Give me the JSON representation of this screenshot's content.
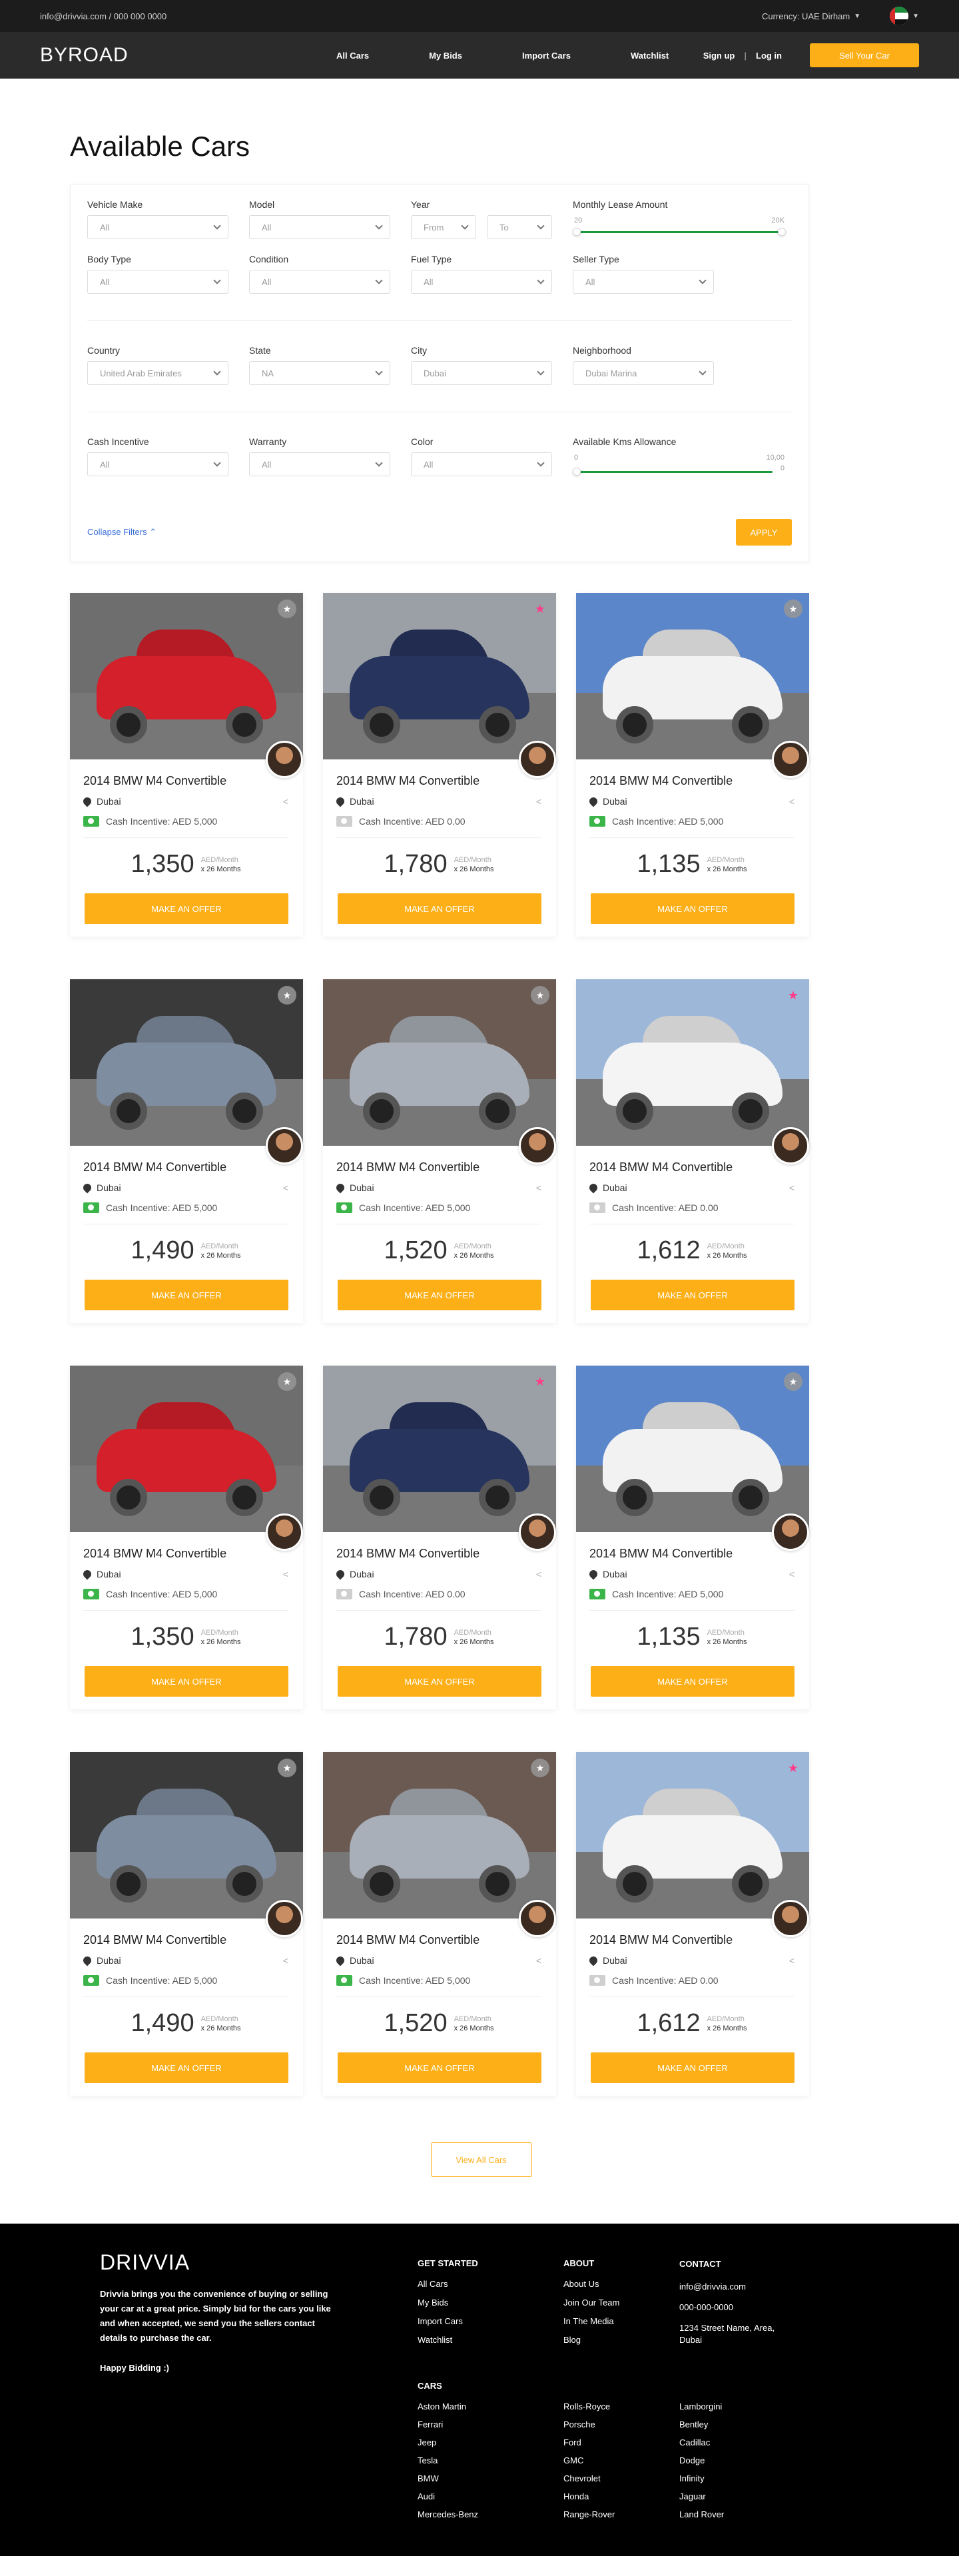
{
  "topbar": {
    "contact": "info@drivvia.com / 000 000 0000",
    "currency": "Currency: UAE Dirham"
  },
  "nav": {
    "logo": "BYROAD",
    "items": [
      "All Cars",
      "My Bids",
      "Import Cars",
      "Watchlist"
    ],
    "signup": "Sign up",
    "separator": "|",
    "login": "Log in",
    "sell_button": "Sell Your Car"
  },
  "page_title": "Available Cars",
  "filters": {
    "vehicle_make": {
      "label": "Vehicle Make",
      "value": "All"
    },
    "model": {
      "label": "Model",
      "value": "All"
    },
    "year": {
      "label": "Year",
      "from": "From",
      "to": "To"
    },
    "lease": {
      "label": "Monthly Lease Amount",
      "min": "20",
      "max": "20K"
    },
    "body_type": {
      "label": "Body Type",
      "value": "All"
    },
    "condition": {
      "label": "Condition",
      "value": "All"
    },
    "fuel_type": {
      "label": "Fuel Type",
      "value": "All"
    },
    "seller_type": {
      "label": "Seller Type",
      "value": "All"
    },
    "country": {
      "label": "Country",
      "value": "United Arab Emirates"
    },
    "state": {
      "label": "State",
      "value": "NA"
    },
    "city": {
      "label": "City",
      "value": "Dubai"
    },
    "neighborhood": {
      "label": "Neighborhood",
      "value": "Dubai Marina"
    },
    "cash_incentive": {
      "label": "Cash Incentive",
      "value": "All"
    },
    "warranty": {
      "label": "Warranty",
      "value": "All"
    },
    "color": {
      "label": "Color",
      "value": "All"
    },
    "kms": {
      "label": "Available Kms Allowance",
      "min": "0",
      "max": "10,00",
      "max2": "0"
    },
    "collapse": "Collapse Filters ⌃",
    "apply": "APPLY"
  },
  "cards": [
    {
      "title": "2014 BMW M4 Convertible",
      "location": "Dubai",
      "cash": "Cash Incentive: AED 5,000",
      "cash_color": "green",
      "price": "1,350",
      "unit": "AED/Month",
      "term": "x 26 Months",
      "offer": "MAKE AN OFFER",
      "fav": "grey",
      "car_color": "#d4202a",
      "sky": "#6e6e6e"
    },
    {
      "title": "2014 BMW M4 Convertible",
      "location": "Dubai",
      "cash": "Cash Incentive: AED 0.00",
      "cash_color": "grey",
      "price": "1,780",
      "unit": "AED/Month",
      "term": "x 26 Months",
      "offer": "MAKE AN OFFER",
      "fav": "pink",
      "car_color": "#27345e",
      "sky": "#9aa0a6"
    },
    {
      "title": "2014 BMW M4 Convertible",
      "location": "Dubai",
      "cash": "Cash Incentive: AED 5,000",
      "cash_color": "green",
      "price": "1,135",
      "unit": "AED/Month",
      "term": "x 26 Months",
      "offer": "MAKE AN OFFER",
      "fav": "grey",
      "car_color": "#f2f2f2",
      "sky": "#5b86c9"
    },
    {
      "title": "2014 BMW M4 Convertible",
      "location": "Dubai",
      "cash": "Cash Incentive: AED 5,000",
      "cash_color": "green",
      "price": "1,490",
      "unit": "AED/Month",
      "term": "x 26 Months",
      "offer": "MAKE AN OFFER",
      "fav": "grey",
      "car_color": "#7f8da0",
      "sky": "#3a3a3a"
    },
    {
      "title": "2014 BMW M4 Convertible",
      "location": "Dubai",
      "cash": "Cash Incentive: AED 5,000",
      "cash_color": "green",
      "price": "1,520",
      "unit": "AED/Month",
      "term": "x 26 Months",
      "offer": "MAKE AN OFFER",
      "fav": "grey",
      "car_color": "#a9afb8",
      "sky": "#6b5a52"
    },
    {
      "title": "2014 BMW M4 Convertible",
      "location": "Dubai",
      "cash": "Cash Incentive: AED 0.00",
      "cash_color": "grey",
      "price": "1,612",
      "unit": "AED/Month",
      "term": "x 26 Months",
      "offer": "MAKE AN OFFER",
      "fav": "pink",
      "car_color": "#f4f4f4",
      "sky": "#9db7d9"
    },
    {
      "title": "2014 BMW M4 Convertible",
      "location": "Dubai",
      "cash": "Cash Incentive: AED 5,000",
      "cash_color": "green",
      "price": "1,350",
      "unit": "AED/Month",
      "term": "x 26 Months",
      "offer": "MAKE AN OFFER",
      "fav": "grey",
      "car_color": "#d4202a",
      "sky": "#6e6e6e"
    },
    {
      "title": "2014 BMW M4 Convertible",
      "location": "Dubai",
      "cash": "Cash Incentive: AED 0.00",
      "cash_color": "grey",
      "price": "1,780",
      "unit": "AED/Month",
      "term": "x 26 Months",
      "offer": "MAKE AN OFFER",
      "fav": "pink",
      "car_color": "#27345e",
      "sky": "#9aa0a6"
    },
    {
      "title": "2014 BMW M4 Convertible",
      "location": "Dubai",
      "cash": "Cash Incentive: AED 5,000",
      "cash_color": "green",
      "price": "1,135",
      "unit": "AED/Month",
      "term": "x 26 Months",
      "offer": "MAKE AN OFFER",
      "fav": "grey",
      "car_color": "#f2f2f2",
      "sky": "#5b86c9"
    },
    {
      "title": "2014 BMW M4 Convertible",
      "location": "Dubai",
      "cash": "Cash Incentive: AED 5,000",
      "cash_color": "green",
      "price": "1,490",
      "unit": "AED/Month",
      "term": "x 26 Months",
      "offer": "MAKE AN OFFER",
      "fav": "grey",
      "car_color": "#7f8da0",
      "sky": "#3a3a3a"
    },
    {
      "title": "2014 BMW M4 Convertible",
      "location": "Dubai",
      "cash": "Cash Incentive: AED 5,000",
      "cash_color": "green",
      "price": "1,520",
      "unit": "AED/Month",
      "term": "x 26 Months",
      "offer": "MAKE AN OFFER",
      "fav": "grey",
      "car_color": "#a9afb8",
      "sky": "#6b5a52"
    },
    {
      "title": "2014 BMW M4 Convertible",
      "location": "Dubai",
      "cash": "Cash Incentive: AED 0.00",
      "cash_color": "grey",
      "price": "1,612",
      "unit": "AED/Month",
      "term": "x 26 Months",
      "offer": "MAKE AN OFFER",
      "fav": "pink",
      "car_color": "#f4f4f4",
      "sky": "#9db7d9"
    }
  ],
  "view_all": "View All Cars",
  "footer": {
    "logo": "DRIVVIA",
    "about": "Drivvia brings you the convenience of buying or selling your car at a great price. Simply bid for the cars you like and when accepted, we send you the sellers contact details to purchase the car.",
    "happy": "Happy Bidding :)",
    "get_started": {
      "title": "GET STARTED",
      "links": [
        "All Cars",
        "My Bids",
        "Import Cars",
        "Watchlist"
      ]
    },
    "about_col": {
      "title": "ABOUT",
      "links": [
        "About Us",
        "Join Our Team",
        "In The Media",
        "Blog"
      ]
    },
    "contact": {
      "title": "CONTACT",
      "email": "info@drivvia.com",
      "phone": "000-000-0000",
      "address": "1234 Street Name, Area, Dubai"
    },
    "cars": {
      "title": "CARS",
      "brands": [
        "Aston Martin",
        "Rolls-Royce",
        "Lamborgini",
        "Ferrari",
        "Porsche",
        "Bentley",
        "Jeep",
        "Ford",
        "Cadillac",
        "Tesla",
        "GMC",
        "Dodge",
        "BMW",
        "Chevrolet",
        "Infinity",
        "Audi",
        "Honda",
        "Jaguar",
        "Mercedes-Benz",
        "Range-Rover",
        "Land Rover"
      ]
    }
  },
  "colors": {
    "accent": "#fcaf17",
    "topbar": "#1c1c1c",
    "nav": "#2b2b2b",
    "footer": "#000000",
    "cash_green": "#3bb54a",
    "fav_pink": "#ff3d8a"
  }
}
